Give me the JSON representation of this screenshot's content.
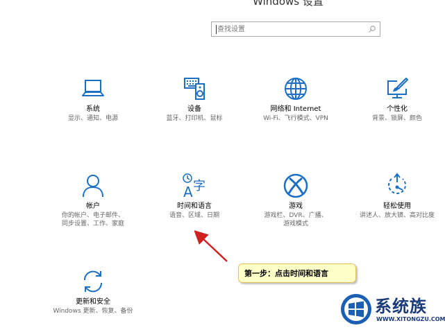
{
  "window": {
    "title": "Windows 设置"
  },
  "search": {
    "placeholder": "查找设置",
    "icon": "search-icon"
  },
  "tiles": [
    {
      "title": "系统",
      "desc": "显示、通知、电源",
      "icon": "laptop-icon"
    },
    {
      "title": "设备",
      "desc": "蓝牙、打印机、鼠标",
      "icon": "keyboard-speaker-icon"
    },
    {
      "title": "网络和 Internet",
      "desc": "Wi-Fi、飞行模式、VPN",
      "icon": "globe-icon"
    },
    {
      "title": "个性化",
      "desc": "背景、锁屏、颜色",
      "icon": "paint-screen-icon"
    },
    {
      "title": "帐户",
      "desc": "你的帐户、电子邮件、同步设置、工作、家庭",
      "icon": "person-icon"
    },
    {
      "title": "时间和语言",
      "desc": "语音、区域、日期",
      "icon": "time-language-icon"
    },
    {
      "title": "游戏",
      "desc": "游戏栏、DVR、广播、游戏模式",
      "icon": "xbox-icon"
    },
    {
      "title": "轻松使用",
      "desc": "讲述人、放大镜、高对比度",
      "icon": "ease-of-access-icon"
    },
    {
      "title": "更新和安全",
      "desc": "Windows 更新、恢复、备份",
      "icon": "sync-icon"
    }
  ],
  "annotation": {
    "text": "第一步：点击时间和语言"
  },
  "watermark": {
    "name": "系统族",
    "url": "WWW.XITONGZU.COM"
  },
  "colors": {
    "accent": "#1a6fc4",
    "callout_bg": "#ffffc8",
    "arrow": "#d02020"
  }
}
